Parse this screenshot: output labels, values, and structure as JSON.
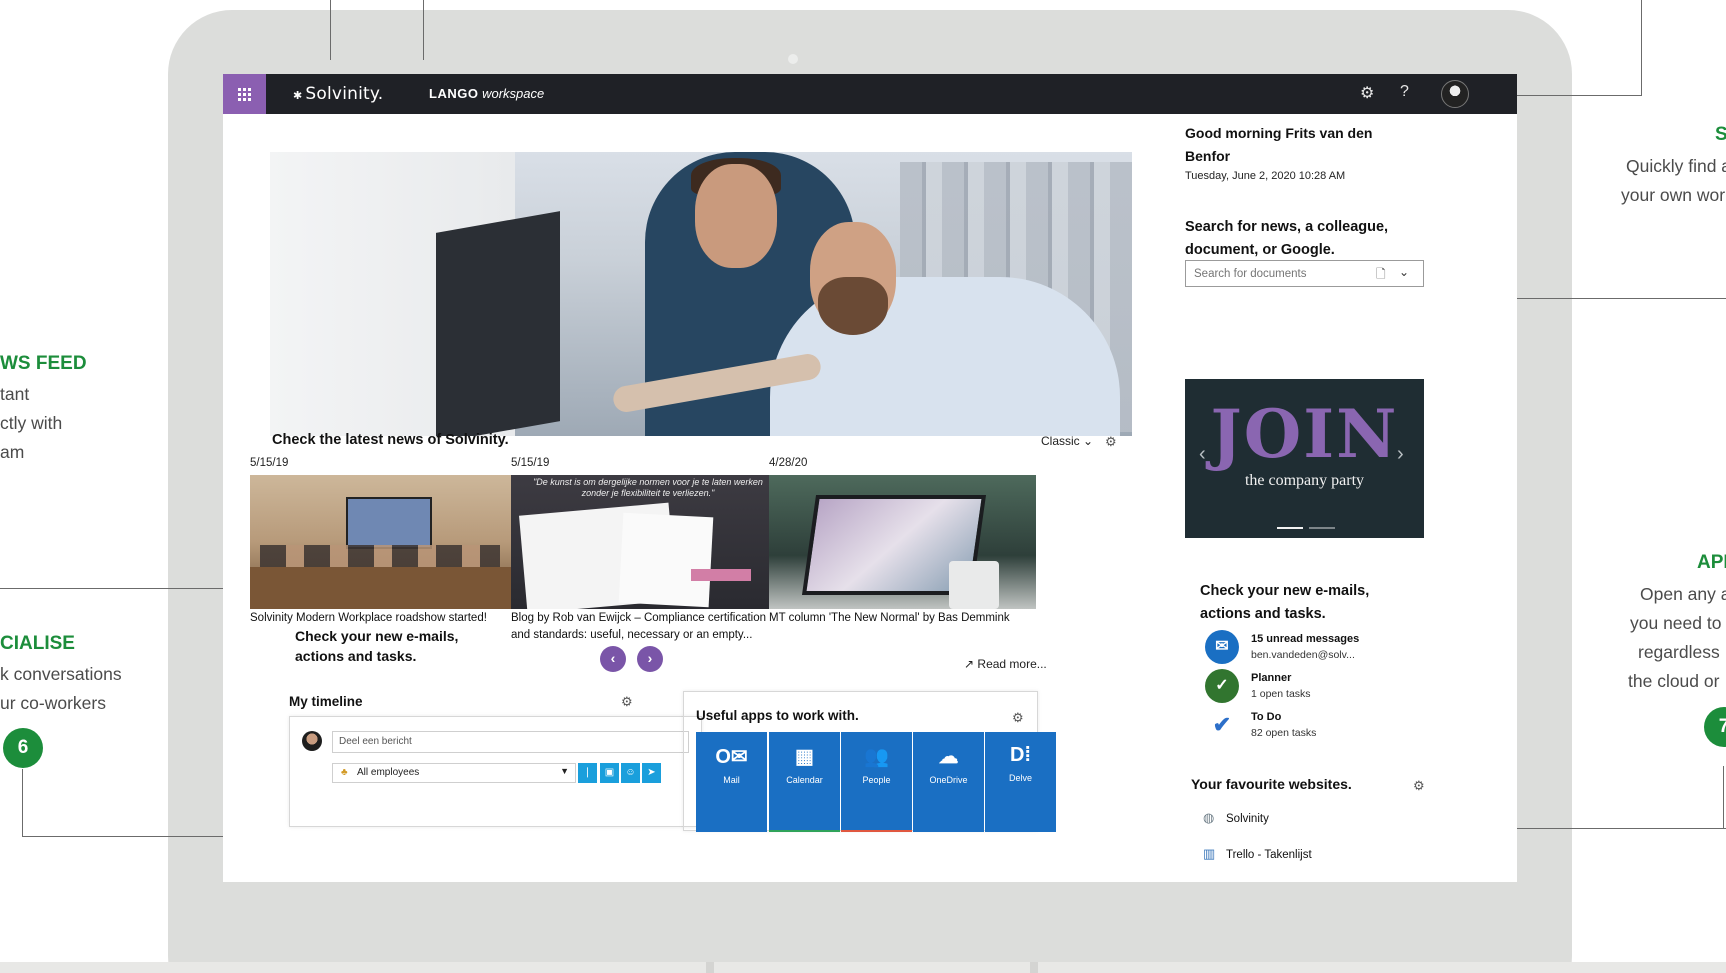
{
  "header": {
    "brand": "Solvinity.",
    "workspace_bold": "LANGO",
    "workspace_italic": "workspace",
    "settings_icon": "gear-icon",
    "help_label": "?"
  },
  "news": {
    "heading": "Check the latest news of Solvinity.",
    "view_label": "Classic",
    "cards": [
      {
        "date": "5/15/19",
        "title": "Solvinity Modern Workplace roadshow started!"
      },
      {
        "date": "5/15/19",
        "title": "Blog by Rob van Ewijck – Compliance certification and standards: useful, necessary or an empty...",
        "image_quote": "\"De kunst is om dergelijke normen voor je te laten werken zonder je flexibiliteit te verliezen.\""
      },
      {
        "date": "4/28/20",
        "title": "MT column 'The New Normal' by Bas Demmink"
      }
    ],
    "prev_label": "‹",
    "next_label": "›",
    "read_more": "Read more..."
  },
  "email_teaser": "Check your new e-mails, actions and tasks.",
  "timeline": {
    "title": "My timeline",
    "input_placeholder": "Deel een bericht",
    "audience": "All employees"
  },
  "apps": {
    "title": "Useful apps to work with.",
    "tiles": [
      {
        "label": "Mail",
        "icon": "outlook-icon",
        "glyph": "O✉",
        "strip": "#1a6fc3"
      },
      {
        "label": "Calendar",
        "icon": "calendar-icon",
        "glyph": "▦",
        "strip": "#2fa35a"
      },
      {
        "label": "People",
        "icon": "people-icon",
        "glyph": "👥",
        "strip": "#e0573f"
      },
      {
        "label": "OneDrive",
        "icon": "onedrive-icon",
        "glyph": "☁",
        "strip": "#1a6fc3"
      },
      {
        "label": "Delve",
        "icon": "delve-icon",
        "glyph": "D⁞",
        "strip": "#1a6fc3"
      }
    ]
  },
  "right": {
    "greeting": "Good morning Frits van den Benfor",
    "datetime": "Tuesday, June 2, 2020  10:28 AM",
    "search_label": "Search for news, a colleague, document, or Google.",
    "search_placeholder": "Search for documents",
    "banner_title": "JOIN",
    "banner_subtitle": "the company party",
    "mail_title": "Check your new e-mails, actions and tasks.",
    "tasks": [
      {
        "title": "15 unread messages",
        "sub": "ben.vandeden@solv...",
        "icon": "mail-icon",
        "color": "#1a6fc3",
        "glyph": "✉"
      },
      {
        "title": "Planner",
        "sub": "1 open tasks",
        "icon": "planner-icon",
        "color": "#31752f",
        "glyph": "✓"
      },
      {
        "title": "To Do",
        "sub": "82 open tasks",
        "icon": "todo-icon",
        "color": "#ffffff",
        "glyph": "✔"
      }
    ],
    "fav_title": "Your favourite websites.",
    "favourites": [
      {
        "label": "Solvinity",
        "icon": "globe-icon",
        "glyph": "🌐"
      },
      {
        "label": "Trello - Takenlijst",
        "icon": "trello-icon",
        "glyph": "▥"
      }
    ]
  },
  "annotations": {
    "left_news_heading": "WS FEED",
    "left_news_lines": [
      "tant",
      "ctly with",
      "am"
    ],
    "left_social_heading": "CIALISE",
    "left_social_lines": [
      "k conversations",
      "ur co-workers"
    ],
    "left_number": "6",
    "right_search_heading": "S",
    "right_search_lines": [
      "Quickly find a",
      "your own wor"
    ],
    "right_apps_heading": "API",
    "right_apps_lines": [
      "Open any a",
      "you need to",
      "regardless",
      "the cloud or"
    ],
    "right_number": "7"
  }
}
